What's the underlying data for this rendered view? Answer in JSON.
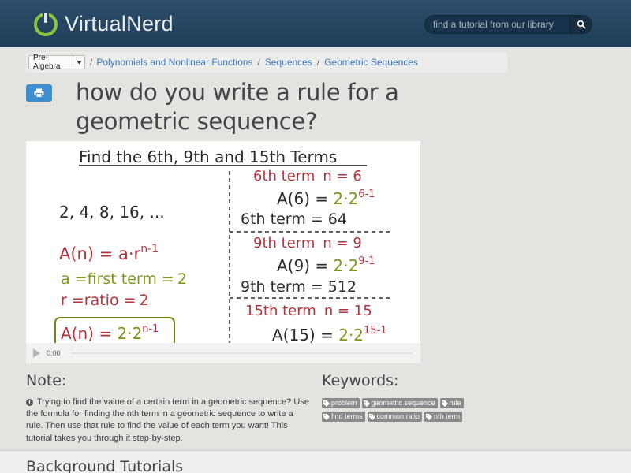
{
  "header": {
    "logo_virtual": "Virtual",
    "logo_nerd": "Nerd",
    "search_placeholder": "find a tutorial from our library",
    "search_icon": "search-icon"
  },
  "breadcrumb": {
    "subject": "Pre-Algebra",
    "items": [
      "Polynomials and Nonlinear Functions",
      "Sequences",
      "Geometric Sequences"
    ],
    "separator": "/"
  },
  "title": "how do you write a rule for a geometric sequence?",
  "video": {
    "heading": "Find the 6th, 9th and 15th Terms",
    "sequence": "2, 4, 8, 16, ...",
    "formula": "A(n) = a·r",
    "formula_exp": "n-1",
    "a_def_label": "a =first term =",
    "a_value": "2",
    "r_def_label": "r =ratio =",
    "r_value": "2",
    "rule_prefix": "A(n) = ",
    "rule_base": "2·2",
    "rule_exp": "n-1",
    "terms": [
      {
        "label": "6th term",
        "n_text": "n = 6",
        "calc_prefix": "A(6) = ",
        "calc_base": "2·2",
        "calc_exp": "6-1",
        "result": "6th term = 64"
      },
      {
        "label": "9th term",
        "n_text": "n = 9",
        "calc_prefix": "A(9) = ",
        "calc_base": "2·2",
        "calc_exp": "9-1",
        "result": "9th term = 512"
      },
      {
        "label": "15th term",
        "n_text": "n = 15",
        "calc_prefix": "A(15) = ",
        "calc_base": "2·2",
        "calc_exp": "15-1",
        "result": ""
      }
    ],
    "time": "0:00"
  },
  "note": {
    "heading": "Note:",
    "text": "Trying to find the value of a certain term in a geometric sequence? Use the formula for finding the nth term in a geometric sequence to write a rule. Then use that rule to find the value of each term you want! This tutorial takes you through it step-by-step."
  },
  "keywords": {
    "heading": "Keywords:",
    "row1": [
      "problem",
      "geometric sequence",
      "rule"
    ],
    "row2": [
      "find terms",
      "common ratio",
      "nth term"
    ]
  },
  "background": {
    "heading": "Background Tutorials"
  },
  "colors": {
    "header": "#244563",
    "link": "#3a78c2",
    "print_button": "#3d8fd1",
    "logo_green": "#8cc63f",
    "tag": "#8a8a8a",
    "chalk_red": "#b5323c",
    "chalk_green": "#7a9a18",
    "chalk_dark": "#2b2b2b"
  }
}
